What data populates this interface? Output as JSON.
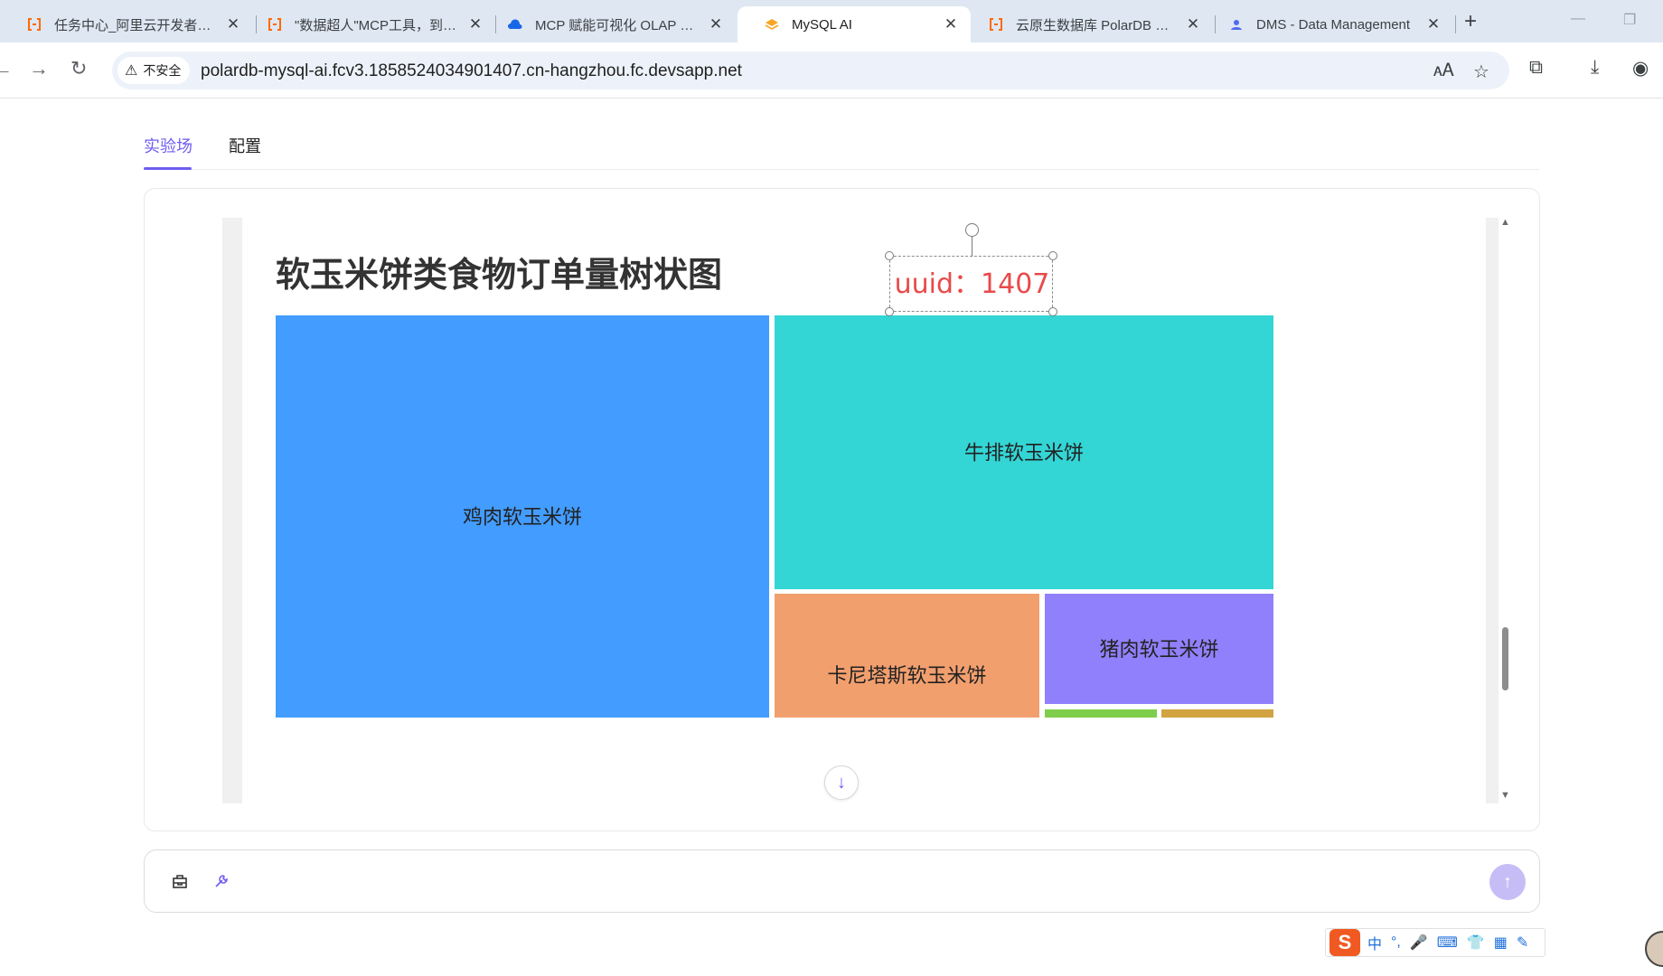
{
  "browser": {
    "tabs": [
      {
        "label": "任务中心_阿里云开发者社区",
        "favicon": "aliyun-icon",
        "active": false
      },
      {
        "label": "\"数据超人\"MCP工具，到底是",
        "favicon": "aliyun-icon",
        "active": false
      },
      {
        "label": "MCP 赋能可视化 OLAP 智能",
        "favicon": "cloud-icon",
        "active": false
      },
      {
        "label": "MySQL AI",
        "favicon": "layers-icon",
        "active": true
      },
      {
        "label": "云原生数据库 PolarDB 控制",
        "favicon": "aliyun-icon",
        "active": false
      },
      {
        "label": "DMS - Data Management",
        "favicon": "dms-icon",
        "active": false
      }
    ],
    "security_label": "不安全",
    "url": "polardb-mysql-ai.fcv3.1858524034901407.cn-hangzhou.fc.devsapp.net"
  },
  "page_tabs": [
    {
      "label": "实验场",
      "active": true
    },
    {
      "label": "配置",
      "active": false
    }
  ],
  "canvas": {
    "uuid_label": "uuid：1407"
  },
  "chart_data": {
    "type": "treemap",
    "title": "软玉米饼类食物订单量树状图",
    "nodes": [
      {
        "name": "鸡肉软玉米饼",
        "color": "#439cff"
      },
      {
        "name": "牛排软玉米饼",
        "color": "#33d5d5"
      },
      {
        "name": "卡尼塔斯软玉米饼",
        "color": "#f29f6e"
      },
      {
        "name": "猪肉软玉米饼",
        "color": "#9180fb"
      },
      {
        "name": "",
        "color": "#7fce4b"
      },
      {
        "name": "",
        "color": "#d1a441"
      }
    ]
  },
  "ime": {
    "items": [
      "中",
      "°,",
      "mic-icon",
      "keyboard-icon",
      "shirt-icon",
      "grid-icon",
      "tool-icon"
    ]
  }
}
